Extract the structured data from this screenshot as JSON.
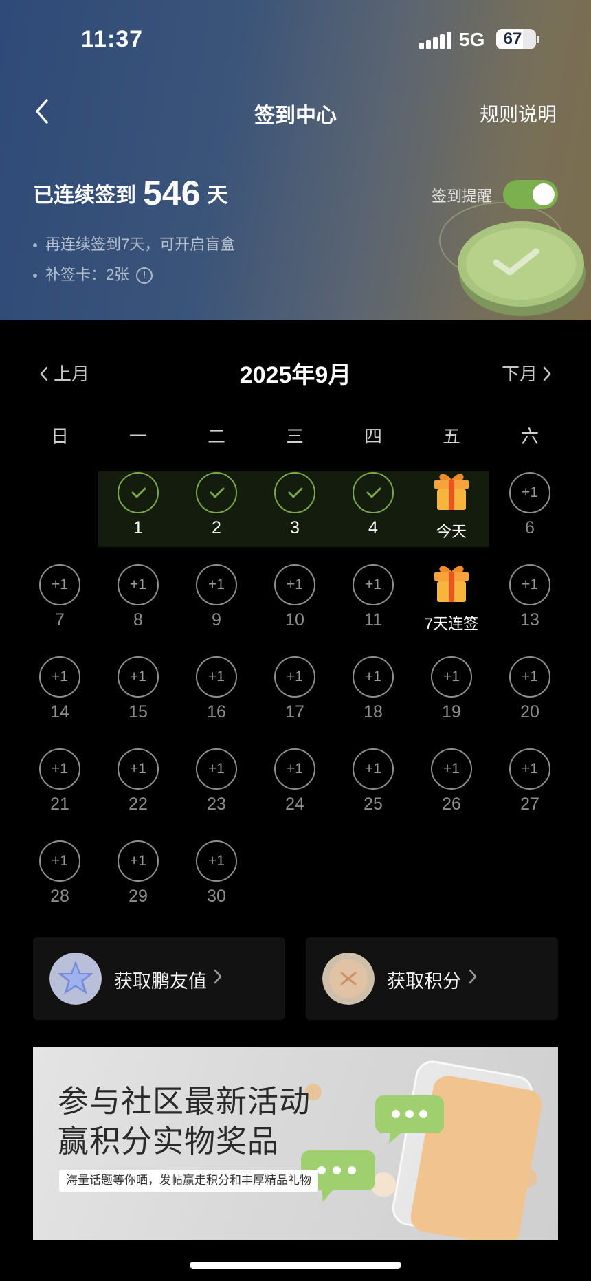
{
  "status_bar": {
    "time": "11:37",
    "network": "5G",
    "battery": "67",
    "battery_level": 0.67
  },
  "nav": {
    "title": "签到中心",
    "rules": "规则说明"
  },
  "summary": {
    "streak_prefix": "已连续签到",
    "streak_days": "546",
    "streak_suffix": "天",
    "tip1": "再连续签到7天，可开启盲盒",
    "tip2": "补签卡：2张",
    "reminder_label": "签到提醒",
    "reminder_on": true
  },
  "calendar": {
    "prev": "上月",
    "next": "下月",
    "month_title": "2025年9月",
    "weekdays": [
      "日",
      "一",
      "二",
      "三",
      "四",
      "五",
      "六"
    ],
    "plus_label": "+1",
    "days": [
      {
        "n": "1",
        "state": "checked"
      },
      {
        "n": "2",
        "state": "checked"
      },
      {
        "n": "3",
        "state": "checked"
      },
      {
        "n": "4",
        "state": "checked"
      },
      {
        "n": "今天",
        "state": "gift"
      },
      {
        "n": "6",
        "state": "pending"
      },
      {
        "n": "7",
        "state": "pending"
      },
      {
        "n": "8",
        "state": "pending"
      },
      {
        "n": "9",
        "state": "pending"
      },
      {
        "n": "10",
        "state": "pending"
      },
      {
        "n": "11",
        "state": "pending"
      },
      {
        "n": "7天连签",
        "state": "gift"
      },
      {
        "n": "13",
        "state": "pending"
      },
      {
        "n": "14",
        "state": "pending"
      },
      {
        "n": "15",
        "state": "pending"
      },
      {
        "n": "16",
        "state": "pending"
      },
      {
        "n": "17",
        "state": "pending"
      },
      {
        "n": "18",
        "state": "pending"
      },
      {
        "n": "19",
        "state": "pending"
      },
      {
        "n": "20",
        "state": "pending"
      },
      {
        "n": "21",
        "state": "pending"
      },
      {
        "n": "22",
        "state": "pending"
      },
      {
        "n": "23",
        "state": "pending"
      },
      {
        "n": "24",
        "state": "pending"
      },
      {
        "n": "25",
        "state": "pending"
      },
      {
        "n": "26",
        "state": "pending"
      },
      {
        "n": "27",
        "state": "pending"
      },
      {
        "n": "28",
        "state": "pending"
      },
      {
        "n": "29",
        "state": "pending"
      },
      {
        "n": "30",
        "state": "pending"
      }
    ]
  },
  "actions": {
    "pengyou": "获取鹏友值",
    "points": "获取积分"
  },
  "banner": {
    "line1": "参与社区最新活动",
    "line2": "赢积分实物奖品",
    "sub": "海量话题等你晒，发帖赢走积分和丰厚精品礼物"
  },
  "colors": {
    "accent_green": "#7cb04e",
    "check_green": "#7aa84a",
    "highlight_row": "#141d0d"
  }
}
